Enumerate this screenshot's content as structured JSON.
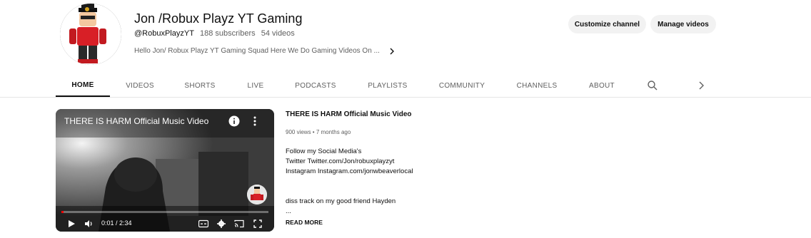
{
  "channel": {
    "name": "Jon /Robux Playz YT Gaming",
    "handle": "@RobuxPlayzYT",
    "subscribers": "188 subscribers",
    "videos": "54 videos",
    "description": "Hello Jon/ Robux Playz YT Gaming Squad Here We Do Gaming Videos On ..."
  },
  "buttons": {
    "customize": "Customize channel",
    "manage": "Manage videos"
  },
  "tabs": [
    "HOME",
    "VIDEOS",
    "SHORTS",
    "LIVE",
    "PODCASTS",
    "PLAYLISTS",
    "COMMUNITY",
    "CHANNELS",
    "ABOUT"
  ],
  "active_tab": "HOME",
  "player": {
    "title": "THERE IS HARM Official Music Video",
    "time": "0:01 / 2:34",
    "progress": 0.01
  },
  "featured": {
    "title": "THERE IS HARM Official Music Video",
    "meta": "900 views • 7 months ago",
    "description_lines": [
      "Follow my Social Media's",
      "Twitter Twitter.com/Jon/robuxplayzyt",
      "Instagram Instagram.com/jonwbeaverlocal",
      "",
      "",
      "diss track on my good friend Hayden",
      "..."
    ],
    "read_more": "READ MORE"
  },
  "colors": {
    "accent": "#ff0000",
    "text": "#0f0f0f",
    "secondary": "#606060",
    "pill": "#f2f2f2"
  }
}
